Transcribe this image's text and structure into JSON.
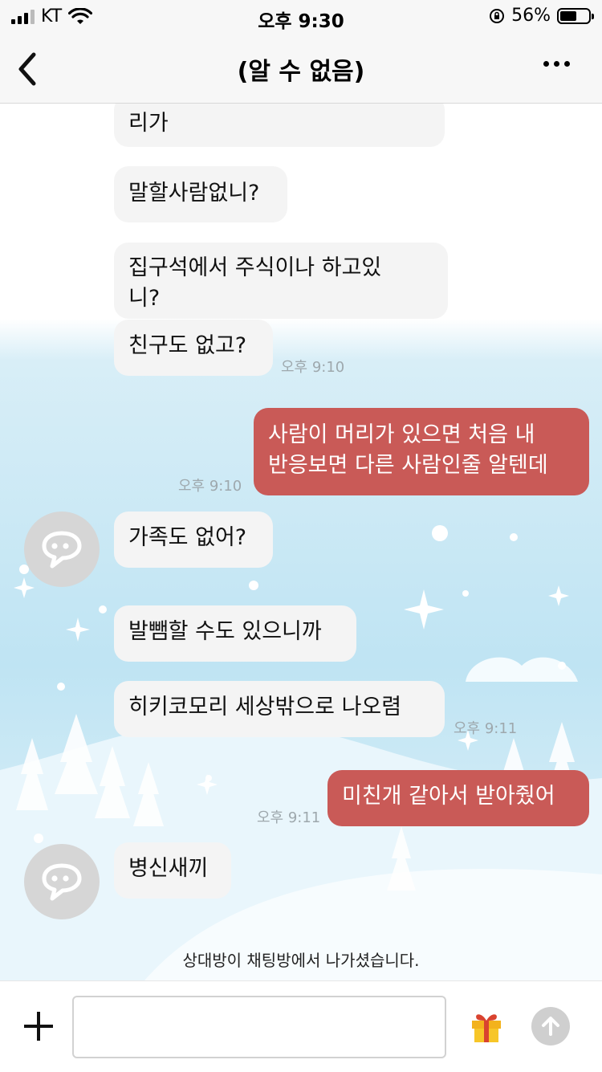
{
  "status": {
    "carrier": "KT",
    "time": "오후 9:30",
    "battery": "56%",
    "battery_level": 0.56
  },
  "header": {
    "title": "(알 수 없음)"
  },
  "messages": [
    {
      "text": "리가"
    },
    {
      "text": "말할사람없니?"
    },
    {
      "text": "집구석에서 주식이나 하고있",
      "text2": "니?"
    },
    {
      "text": "친구도 없고?",
      "time": "오후 9:10"
    },
    {
      "text": "사람이 머리가 있으면 처음 내",
      "text2": "반응보면 다른 사람인줄 알텐데",
      "time": "오후 9:10"
    },
    {
      "text": "가족도 없어?"
    },
    {
      "text": "발뺌할 수도 있으니까"
    },
    {
      "text": "히키코모리 세상밖으로 나오렴",
      "time": "오후 9:11"
    },
    {
      "text": "미친개 같아서 받아줬어",
      "time": "오후 9:11"
    },
    {
      "text": "병신새끼"
    }
  ],
  "notice": "상대방이 채팅방에서 나가셨습니다.",
  "input": {
    "value": ""
  },
  "icons": {
    "back": "chevron-left-icon",
    "more": "more-dots-icon",
    "attach": "plus-icon",
    "gift": "gift-icon",
    "send": "arrow-up-icon"
  },
  "colors": {
    "outgoing_bubble": "#c95a57",
    "incoming_bubble": "#f4f4f4",
    "background": "#bfe4f3"
  }
}
